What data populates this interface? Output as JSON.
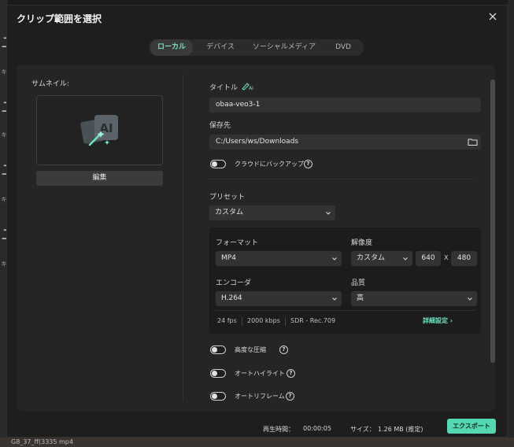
{
  "dialog": {
    "title": "クリップ範囲を選択"
  },
  "tabs": [
    {
      "label": "ローカル",
      "active": true
    },
    {
      "label": "デバイス",
      "active": false
    },
    {
      "label": "ソーシャルメディア",
      "active": false
    },
    {
      "label": "DVD",
      "active": false
    }
  ],
  "thumbnail": {
    "label": "サムネイル:",
    "edit_label": "編集",
    "icon": "ai-image-icon"
  },
  "title_field": {
    "label": "タイトル",
    "value": "obaa-veo3-1",
    "ai_icon": "ai-rename-icon"
  },
  "save_to": {
    "label": "保存先",
    "value": "C:/Users/ws/Downloads",
    "icon": "folder-icon"
  },
  "cloud_backup": {
    "label": "クラウドにバックアップ",
    "enabled": false
  },
  "preset": {
    "label": "プリセット",
    "value": "カスタム"
  },
  "format": {
    "label": "フォーマット",
    "value": "MP4"
  },
  "resolution": {
    "label": "解像度",
    "value": "カスタム",
    "width": "640",
    "x_label": "X",
    "height": "480"
  },
  "encoder": {
    "label": "エンコーダ",
    "value": "H.264"
  },
  "quality": {
    "label": "品質",
    "value": "高"
  },
  "summary": {
    "fps": "24 fps",
    "bitrate": "2000 kbps",
    "hdr": "SDR - Rec.709",
    "advanced_label": "詳細設定 ›"
  },
  "options": [
    {
      "label": "高度な圧縮",
      "enabled": false
    },
    {
      "label": "オートハイライト",
      "enabled": false
    },
    {
      "label": "オートリフレーム",
      "enabled": false
    }
  ],
  "footer": {
    "duration_label": "再生時間：",
    "duration_value": "00:00:05",
    "size_label": "サイズ：",
    "size_value": "1.26 MB (推定)",
    "export_label": "エクスポート"
  },
  "background": {
    "left_glyphs": [
      "ユ",
      "キ",
      "ユ",
      "キ",
      "ユ",
      "キ",
      "ユ",
      "キ"
    ],
    "bottom_text": "G8_37_ff(3335 mp4"
  },
  "colors": {
    "accent": "#55d7b2",
    "accent_text": "#6fe3c3",
    "dialog_bg": "#1e1e1e",
    "panel_bg": "#252525"
  }
}
